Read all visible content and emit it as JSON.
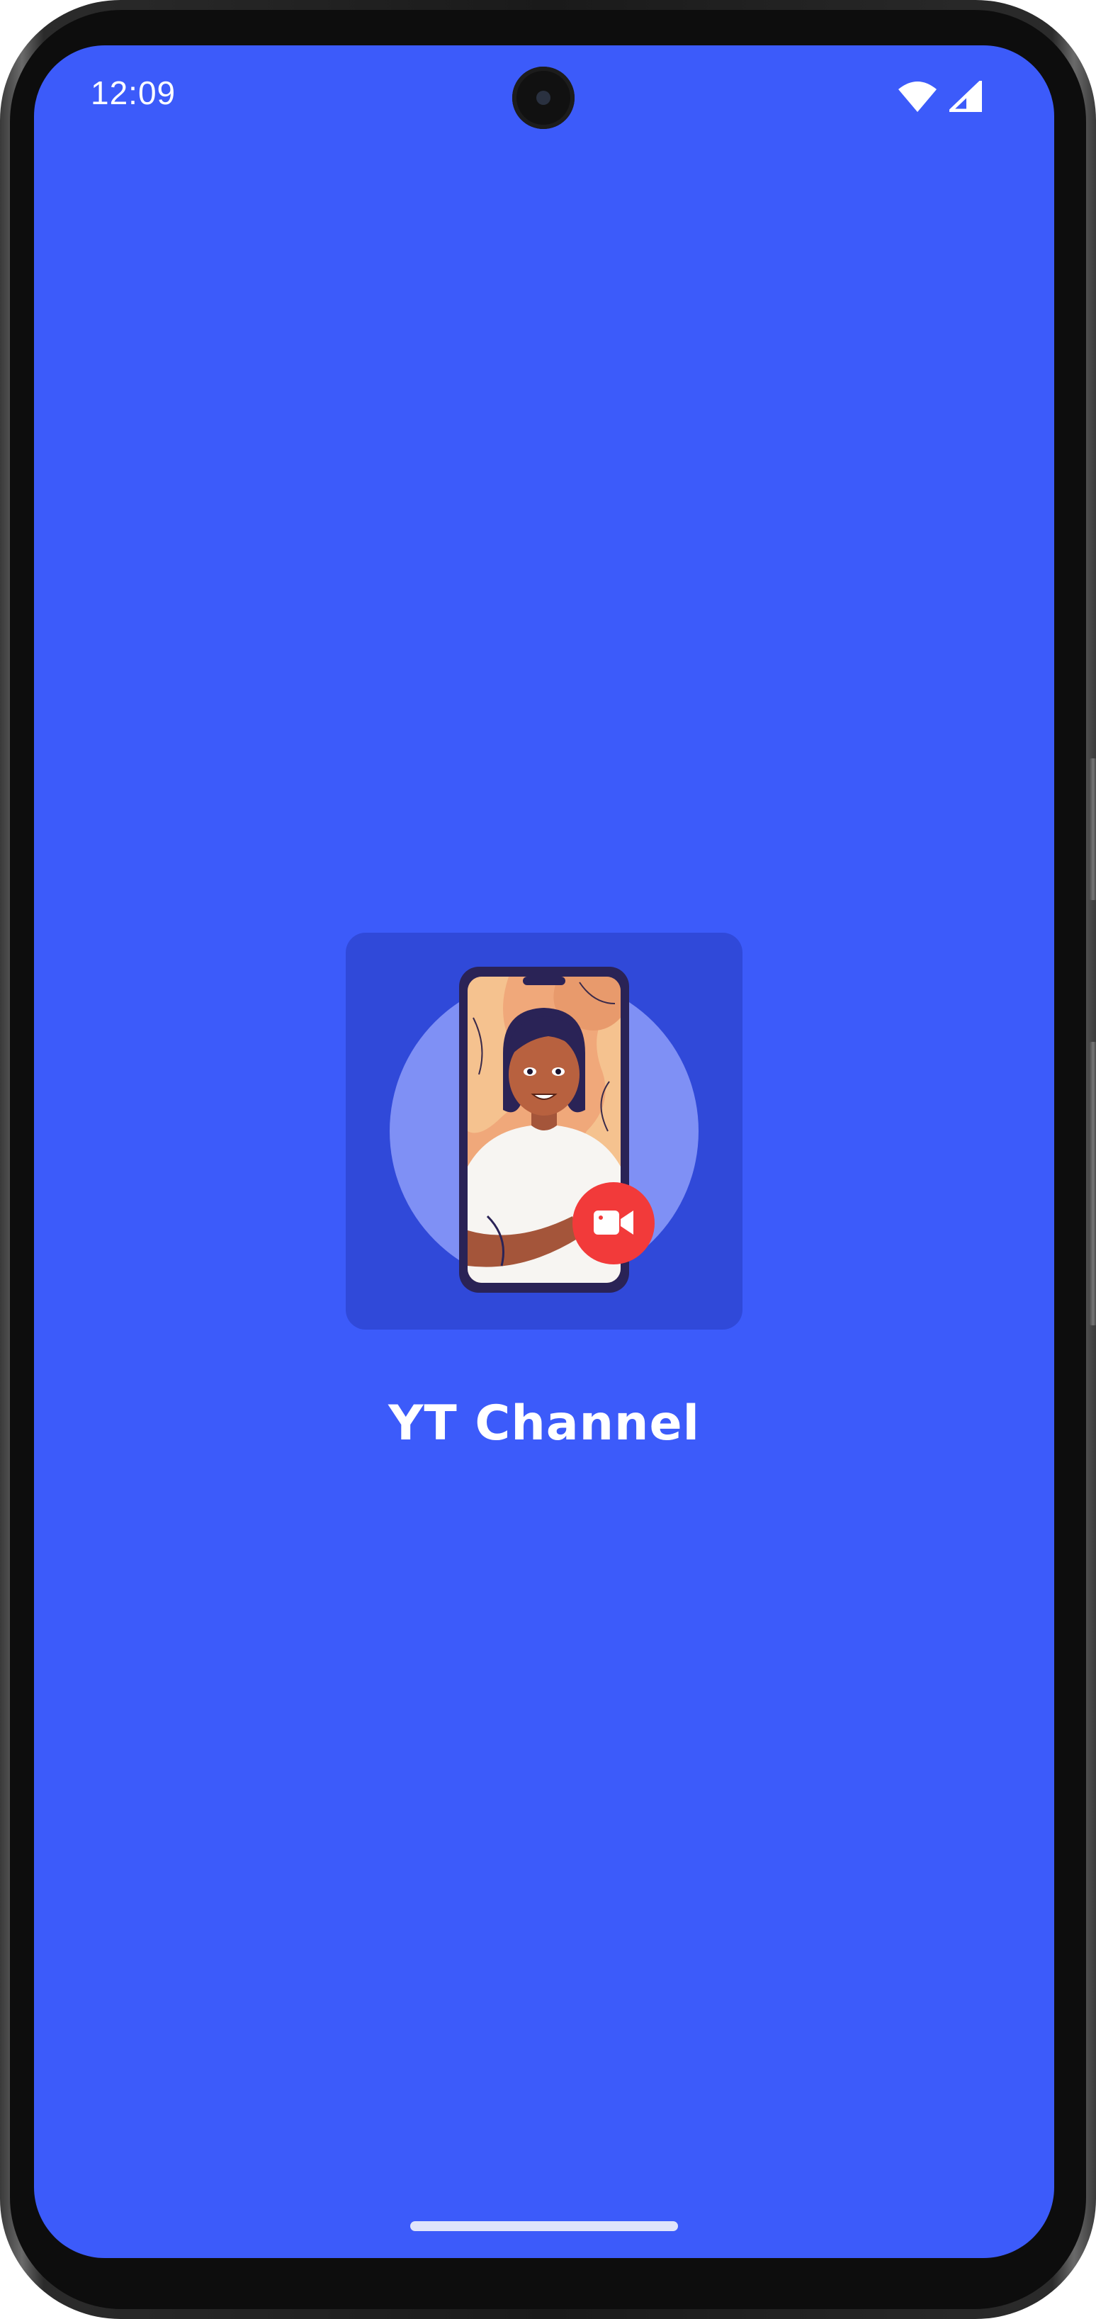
{
  "status_bar": {
    "time": "12:09",
    "icons": [
      "wifi-icon",
      "cellular-signal-icon"
    ]
  },
  "splash": {
    "app_name": "YT Channel",
    "app_icon": "video-call-illustration-icon"
  },
  "colors": {
    "background": "#3c5bfa",
    "icon_tile": "#3049d9",
    "icon_circle": "#7f90f5",
    "record_badge": "#f23a3a",
    "text": "#ffffff"
  }
}
